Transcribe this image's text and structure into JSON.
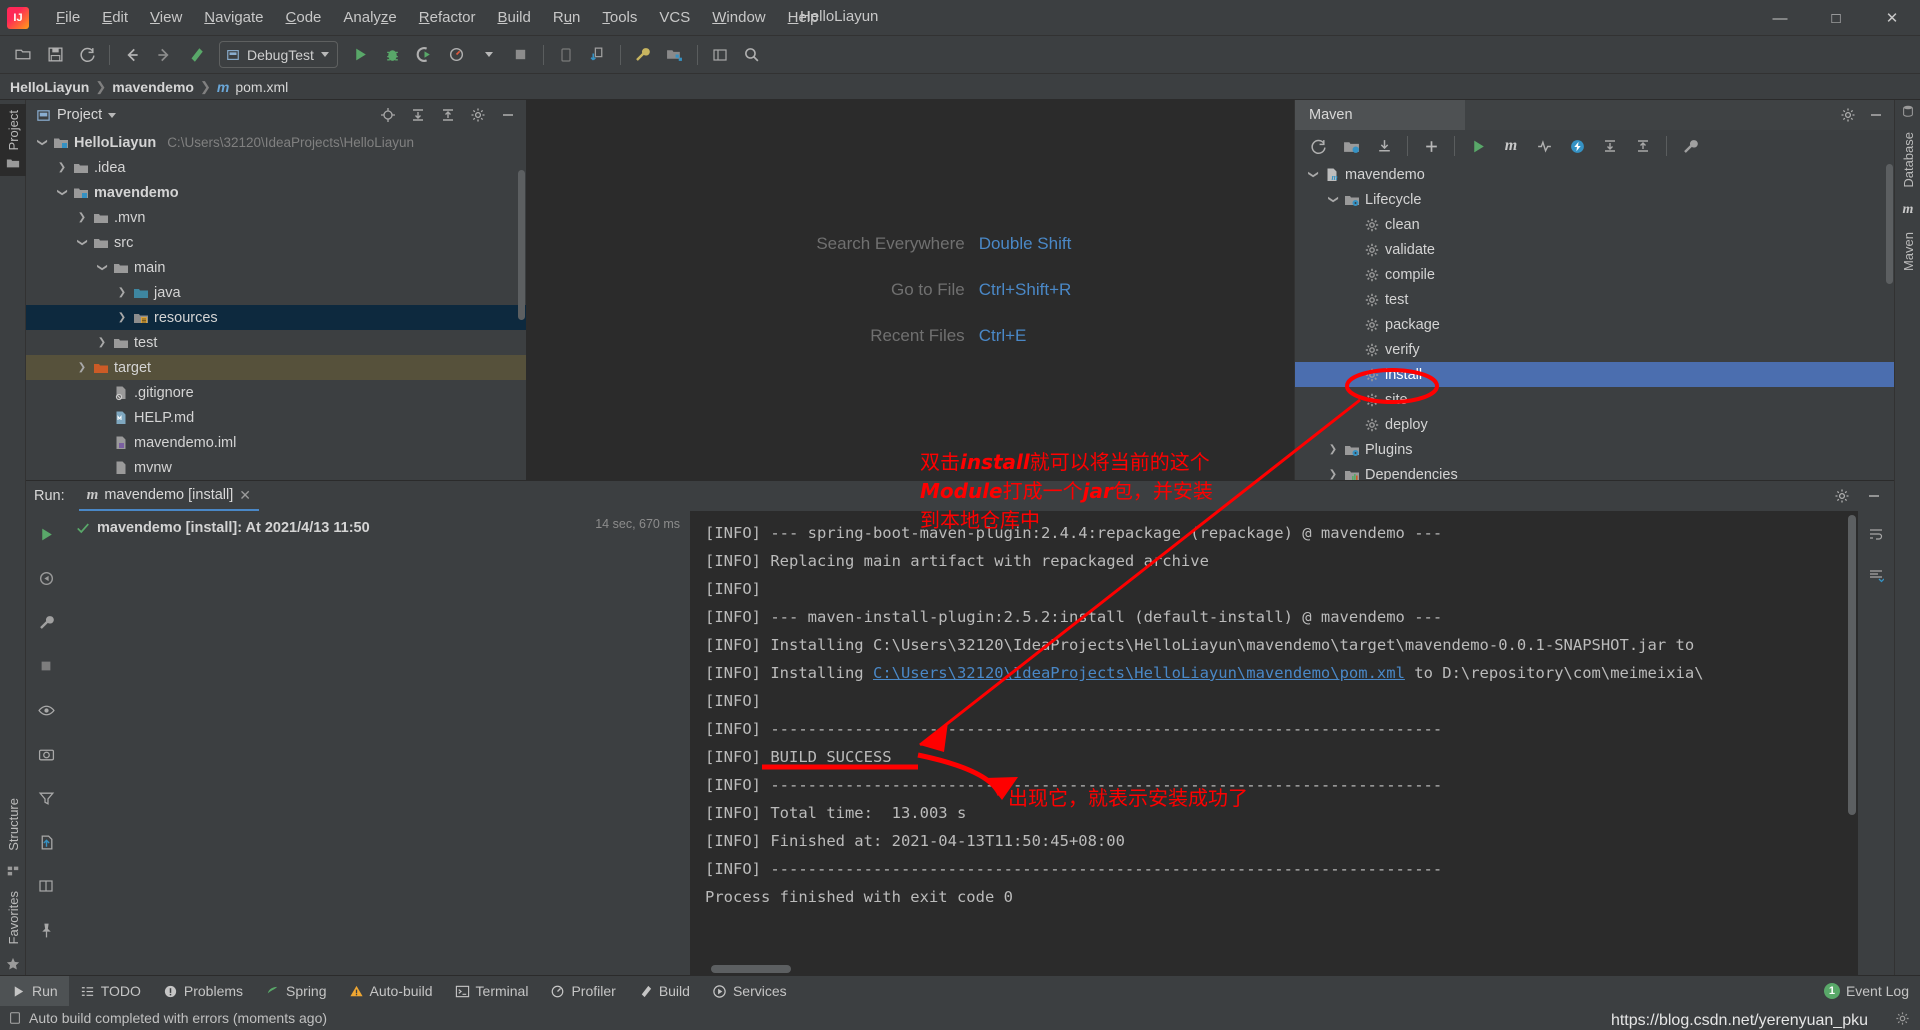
{
  "window": {
    "title": "HelloLiayun",
    "logo": "intellij-idea-logo",
    "controls": [
      "minimize",
      "maximize",
      "close"
    ]
  },
  "menu": [
    {
      "label": "File",
      "mnemonic": "F"
    },
    {
      "label": "Edit",
      "mnemonic": "E"
    },
    {
      "label": "View",
      "mnemonic": "V"
    },
    {
      "label": "Navigate",
      "mnemonic": "N"
    },
    {
      "label": "Code",
      "mnemonic": "C"
    },
    {
      "label": "Analyze",
      "mnemonic": "z"
    },
    {
      "label": "Refactor",
      "mnemonic": "R"
    },
    {
      "label": "Build",
      "mnemonic": "B"
    },
    {
      "label": "Run",
      "mnemonic": "u"
    },
    {
      "label": "Tools",
      "mnemonic": "T"
    },
    {
      "label": "VCS",
      "mnemonic": ""
    },
    {
      "label": "Window",
      "mnemonic": "W"
    },
    {
      "label": "Help",
      "mnemonic": "H"
    }
  ],
  "toolbar": {
    "run_config": "DebugTest",
    "buttons": [
      "open-folder-icon",
      "save-all-icon",
      "sync-icon",
      "back-icon",
      "forward-icon",
      "build-hammer-icon",
      "run-icon",
      "debug-icon",
      "run-coverage-icon",
      "profile-icon",
      "stop-icon",
      "device-manager-icon",
      "update-project-icon",
      "settings-wrench-icon",
      "project-structure-icon",
      "layout-icon",
      "search-icon"
    ]
  },
  "breadcrumb": [
    "HelloLiayun",
    "mavendemo",
    "pom.xml"
  ],
  "left_rail": {
    "top_label": "Project",
    "bottom_labels": [
      "Structure",
      "Favorites"
    ]
  },
  "right_rail": {
    "labels": [
      "Database",
      "Maven"
    ]
  },
  "project_panel": {
    "title": "Project",
    "header_buttons": [
      "locate-icon",
      "expand-all-icon",
      "collapse-all-icon",
      "gear-icon",
      "hide-icon"
    ],
    "tree": [
      {
        "label": "HelloLiayun",
        "path": "C:\\Users\\32120\\IdeaProjects\\HelloLiayun",
        "indent": 0,
        "chevron": "down",
        "icon": "module-folder-icon",
        "bold": true,
        "state": "normal"
      },
      {
        "label": ".idea",
        "path": "",
        "indent": 1,
        "chevron": "right",
        "icon": "folder-icon",
        "bold": false,
        "state": "normal"
      },
      {
        "label": "mavendemo",
        "path": "",
        "indent": 1,
        "chevron": "down",
        "icon": "module-folder-icon",
        "bold": true,
        "state": "normal"
      },
      {
        "label": ".mvn",
        "path": "",
        "indent": 2,
        "chevron": "right",
        "icon": "folder-icon",
        "bold": false,
        "state": "normal"
      },
      {
        "label": "src",
        "path": "",
        "indent": 2,
        "chevron": "down",
        "icon": "folder-icon",
        "bold": false,
        "state": "normal"
      },
      {
        "label": "main",
        "path": "",
        "indent": 3,
        "chevron": "down",
        "icon": "folder-icon",
        "bold": false,
        "state": "normal"
      },
      {
        "label": "java",
        "path": "",
        "indent": 4,
        "chevron": "right",
        "icon": "source-folder-icon",
        "bold": false,
        "state": "normal"
      },
      {
        "label": "resources",
        "path": "",
        "indent": 4,
        "chevron": "right",
        "icon": "resources-folder-icon",
        "bold": false,
        "state": "selected"
      },
      {
        "label": "test",
        "path": "",
        "indent": 3,
        "chevron": "right",
        "icon": "folder-icon",
        "bold": false,
        "state": "normal"
      },
      {
        "label": "target",
        "path": "",
        "indent": 2,
        "chevron": "right",
        "icon": "excluded-folder-icon",
        "bold": false,
        "state": "target"
      },
      {
        "label": ".gitignore",
        "path": "",
        "indent": 3,
        "chevron": "",
        "icon": "gitignore-file-icon",
        "bold": false,
        "state": "normal"
      },
      {
        "label": "HELP.md",
        "path": "",
        "indent": 3,
        "chevron": "",
        "icon": "markdown-file-icon",
        "bold": false,
        "state": "normal"
      },
      {
        "label": "mavendemo.iml",
        "path": "",
        "indent": 3,
        "chevron": "",
        "icon": "iml-file-icon",
        "bold": false,
        "state": "normal"
      },
      {
        "label": "mvnw",
        "path": "",
        "indent": 3,
        "chevron": "",
        "icon": "file-icon",
        "bold": false,
        "state": "normal"
      }
    ]
  },
  "editor": {
    "hints": [
      {
        "label": "Search Everywhere",
        "key": "Double Shift"
      },
      {
        "label": "Go to File",
        "key": "Ctrl+Shift+R"
      },
      {
        "label": "Recent Files",
        "key": "Ctrl+E"
      }
    ]
  },
  "maven_panel": {
    "tab_label": "Maven",
    "header_buttons": [
      "gear-icon",
      "hide-icon"
    ],
    "toolbar_buttons": [
      "reload-icon",
      "add-maven-project-icon",
      "download-sources-icon",
      "add-icon",
      "run-icon",
      "maven-m-icon",
      "skip-tests-icon",
      "execute-goal-icon",
      "expand-all-icon",
      "collapse-all-icon",
      "settings-wrench-icon"
    ],
    "tree": [
      {
        "label": "mavendemo",
        "indent": 0,
        "chevron": "down",
        "icon": "maven-project-icon",
        "state": "normal"
      },
      {
        "label": "Lifecycle",
        "indent": 1,
        "chevron": "down",
        "icon": "lifecycle-folder-icon",
        "state": "normal"
      },
      {
        "label": "clean",
        "indent": 2,
        "chevron": "",
        "icon": "maven-goal-icon",
        "state": "normal"
      },
      {
        "label": "validate",
        "indent": 2,
        "chevron": "",
        "icon": "maven-goal-icon",
        "state": "normal"
      },
      {
        "label": "compile",
        "indent": 2,
        "chevron": "",
        "icon": "maven-goal-icon",
        "state": "normal"
      },
      {
        "label": "test",
        "indent": 2,
        "chevron": "",
        "icon": "maven-goal-icon",
        "state": "normal"
      },
      {
        "label": "package",
        "indent": 2,
        "chevron": "",
        "icon": "maven-goal-icon",
        "state": "normal"
      },
      {
        "label": "verify",
        "indent": 2,
        "chevron": "",
        "icon": "maven-goal-icon",
        "state": "normal"
      },
      {
        "label": "install",
        "indent": 2,
        "chevron": "",
        "icon": "maven-goal-icon",
        "state": "selected"
      },
      {
        "label": "site",
        "indent": 2,
        "chevron": "",
        "icon": "maven-goal-icon",
        "state": "normal"
      },
      {
        "label": "deploy",
        "indent": 2,
        "chevron": "",
        "icon": "maven-goal-icon",
        "state": "normal"
      },
      {
        "label": "Plugins",
        "indent": 1,
        "chevron": "right",
        "icon": "plugins-folder-icon",
        "state": "normal"
      },
      {
        "label": "Dependencies",
        "indent": 1,
        "chevron": "right",
        "icon": "dependencies-folder-icon",
        "state": "normal"
      }
    ]
  },
  "run_panel": {
    "title": "Run:",
    "tab_label": "mavendemo [install]",
    "tab_icon": "maven-m-icon",
    "close_icon": "close-icon",
    "header_buttons": [
      "gear-icon",
      "hide-icon"
    ],
    "gutter_buttons": [
      "rerun-icon",
      "rerun-failed-icon",
      "settings-wrench-icon",
      "stop-icon",
      "eye-icon",
      "camera-icon",
      "filter-icon",
      "export-icon",
      "layout-icon",
      "pin-icon"
    ],
    "right_gutter_buttons": [
      "soft-wrap-icon",
      "scroll-to-end-icon"
    ],
    "tree_row": {
      "label": "mavendemo [install]: At 2021/4/13 11:50",
      "status_icon": "success-check-icon",
      "duration": "14 sec, 670 ms"
    },
    "console_lines": [
      {
        "text": "[INFO] --- spring-boot-maven-plugin:2.4.4:repackage (repackage) @ mavendemo ---",
        "link": ""
      },
      {
        "text": "[INFO] Replacing main artifact with repackaged archive",
        "link": ""
      },
      {
        "text": "[INFO] ",
        "link": ""
      },
      {
        "text": "[INFO] --- maven-install-plugin:2.5.2:install (default-install) @ mavendemo ---",
        "link": ""
      },
      {
        "text": "[INFO] Installing C:\\Users\\32120\\IdeaProjects\\HelloLiayun\\mavendemo\\target\\mavendemo-0.0.1-SNAPSHOT.jar to",
        "link": ""
      },
      {
        "prefix": "[INFO] Installing ",
        "link": "C:\\Users\\32120\\IdeaProjects\\HelloLiayun\\mavendemo\\pom.xml",
        "suffix": " to D:\\repository\\com\\meimeixia\\"
      },
      {
        "text": "[INFO] ",
        "link": ""
      },
      {
        "text": "[INFO] ------------------------------------------------------------------------",
        "link": ""
      },
      {
        "text": "[INFO] BUILD SUCCESS",
        "link": ""
      },
      {
        "text": "[INFO] ------------------------------------------------------------------------",
        "link": ""
      },
      {
        "text": "[INFO] Total time:  13.003 s",
        "link": ""
      },
      {
        "text": "[INFO] Finished at: 2021-04-13T11:50:45+08:00",
        "link": ""
      },
      {
        "text": "[INFO] ------------------------------------------------------------------------",
        "link": ""
      },
      {
        "text": "",
        "link": ""
      },
      {
        "text": "Process finished with exit code 0",
        "link": ""
      }
    ]
  },
  "annotations": {
    "color": "#ff0000",
    "install_note": {
      "line1_a": "双击",
      "line1_em": "install",
      "line1_b": "就可以将当前的这个",
      "line2_em": "Module",
      "line2_b": "打成一个",
      "line2_em2": "jar",
      "line2_c": "包，并安装",
      "line3": "到本地仓库中"
    },
    "success_note": "出现它，就表示安装成功了"
  },
  "bottom_bar": {
    "items": [
      {
        "label": "Run",
        "icon": "run-icon",
        "active": true
      },
      {
        "label": "TODO",
        "icon": "todo-icon",
        "active": false
      },
      {
        "label": "Problems",
        "icon": "problems-icon",
        "active": false
      },
      {
        "label": "Spring",
        "icon": "spring-leaf-icon",
        "active": false
      },
      {
        "label": "Auto-build",
        "icon": "warning-triangle-icon",
        "active": false
      },
      {
        "label": "Terminal",
        "icon": "terminal-icon",
        "active": false
      },
      {
        "label": "Profiler",
        "icon": "profiler-icon",
        "active": false
      },
      {
        "label": "Build",
        "icon": "build-hammer-icon",
        "active": false
      },
      {
        "label": "Services",
        "icon": "services-icon",
        "active": false
      }
    ],
    "event_log": {
      "label": "Event Log",
      "count": "1"
    }
  },
  "status_bar": {
    "message": "Auto build completed with errors (moments ago)",
    "icon": "build-status-icon"
  },
  "watermark": "https://blog.csdn.net/yerenyuan_pku"
}
